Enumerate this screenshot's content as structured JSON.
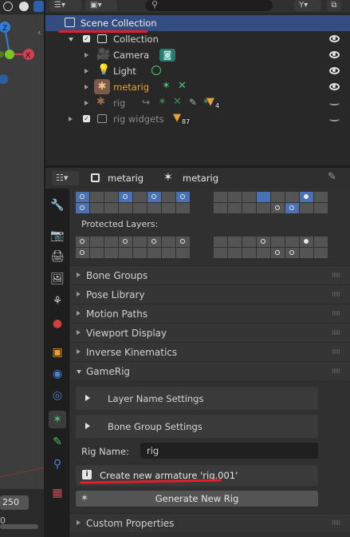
{
  "outliner": {
    "scene_collection": "Scene Collection",
    "rows": [
      {
        "label": "Collection"
      },
      {
        "label": "Camera"
      },
      {
        "label": "Light"
      },
      {
        "label": "metarig"
      },
      {
        "label": "rig",
        "badge": "4"
      },
      {
        "label": "rig widgets",
        "badge": "87"
      }
    ]
  },
  "properties": {
    "header": {
      "object_name": "metarig",
      "data_name": "metarig"
    },
    "protected_layers_label": "Protected Layers:",
    "panels": [
      "Bone Groups",
      "Pose Library",
      "Motion Paths",
      "Viewport Display",
      "Inverse Kinematics"
    ],
    "gamerig": {
      "title": "GameRig",
      "layer_name_settings": "Layer Name Settings",
      "bone_group_settings": "Bone Group Settings",
      "rig_name_label": "Rig Name:",
      "rig_name_value": "rig",
      "info_message": "Create new armature 'rig.001'",
      "generate_button": "Generate New Rig"
    },
    "custom_properties": "Custom Properties"
  },
  "viewport": {
    "frame_end": "250",
    "frame_start_partial": "0"
  },
  "colors": {
    "accent": "#4a72b3",
    "selected_row": "#334d80",
    "annotation": "#e0202a",
    "active_object": "#f0a030"
  },
  "icons": [
    "scene-collection-icon",
    "collection-icon",
    "camera-icon",
    "light-icon",
    "armature-icon",
    "eye-icon",
    "wrench-icon",
    "render-icon",
    "output-icon",
    "view-layer-icon",
    "scene-icon",
    "world-icon",
    "object-icon",
    "modifier-icon",
    "particles-icon",
    "physics-icon",
    "constraint-icon",
    "object-data-icon",
    "bone-icon",
    "texture-icon",
    "info-icon",
    "pin-icon",
    "filter-icon"
  ]
}
